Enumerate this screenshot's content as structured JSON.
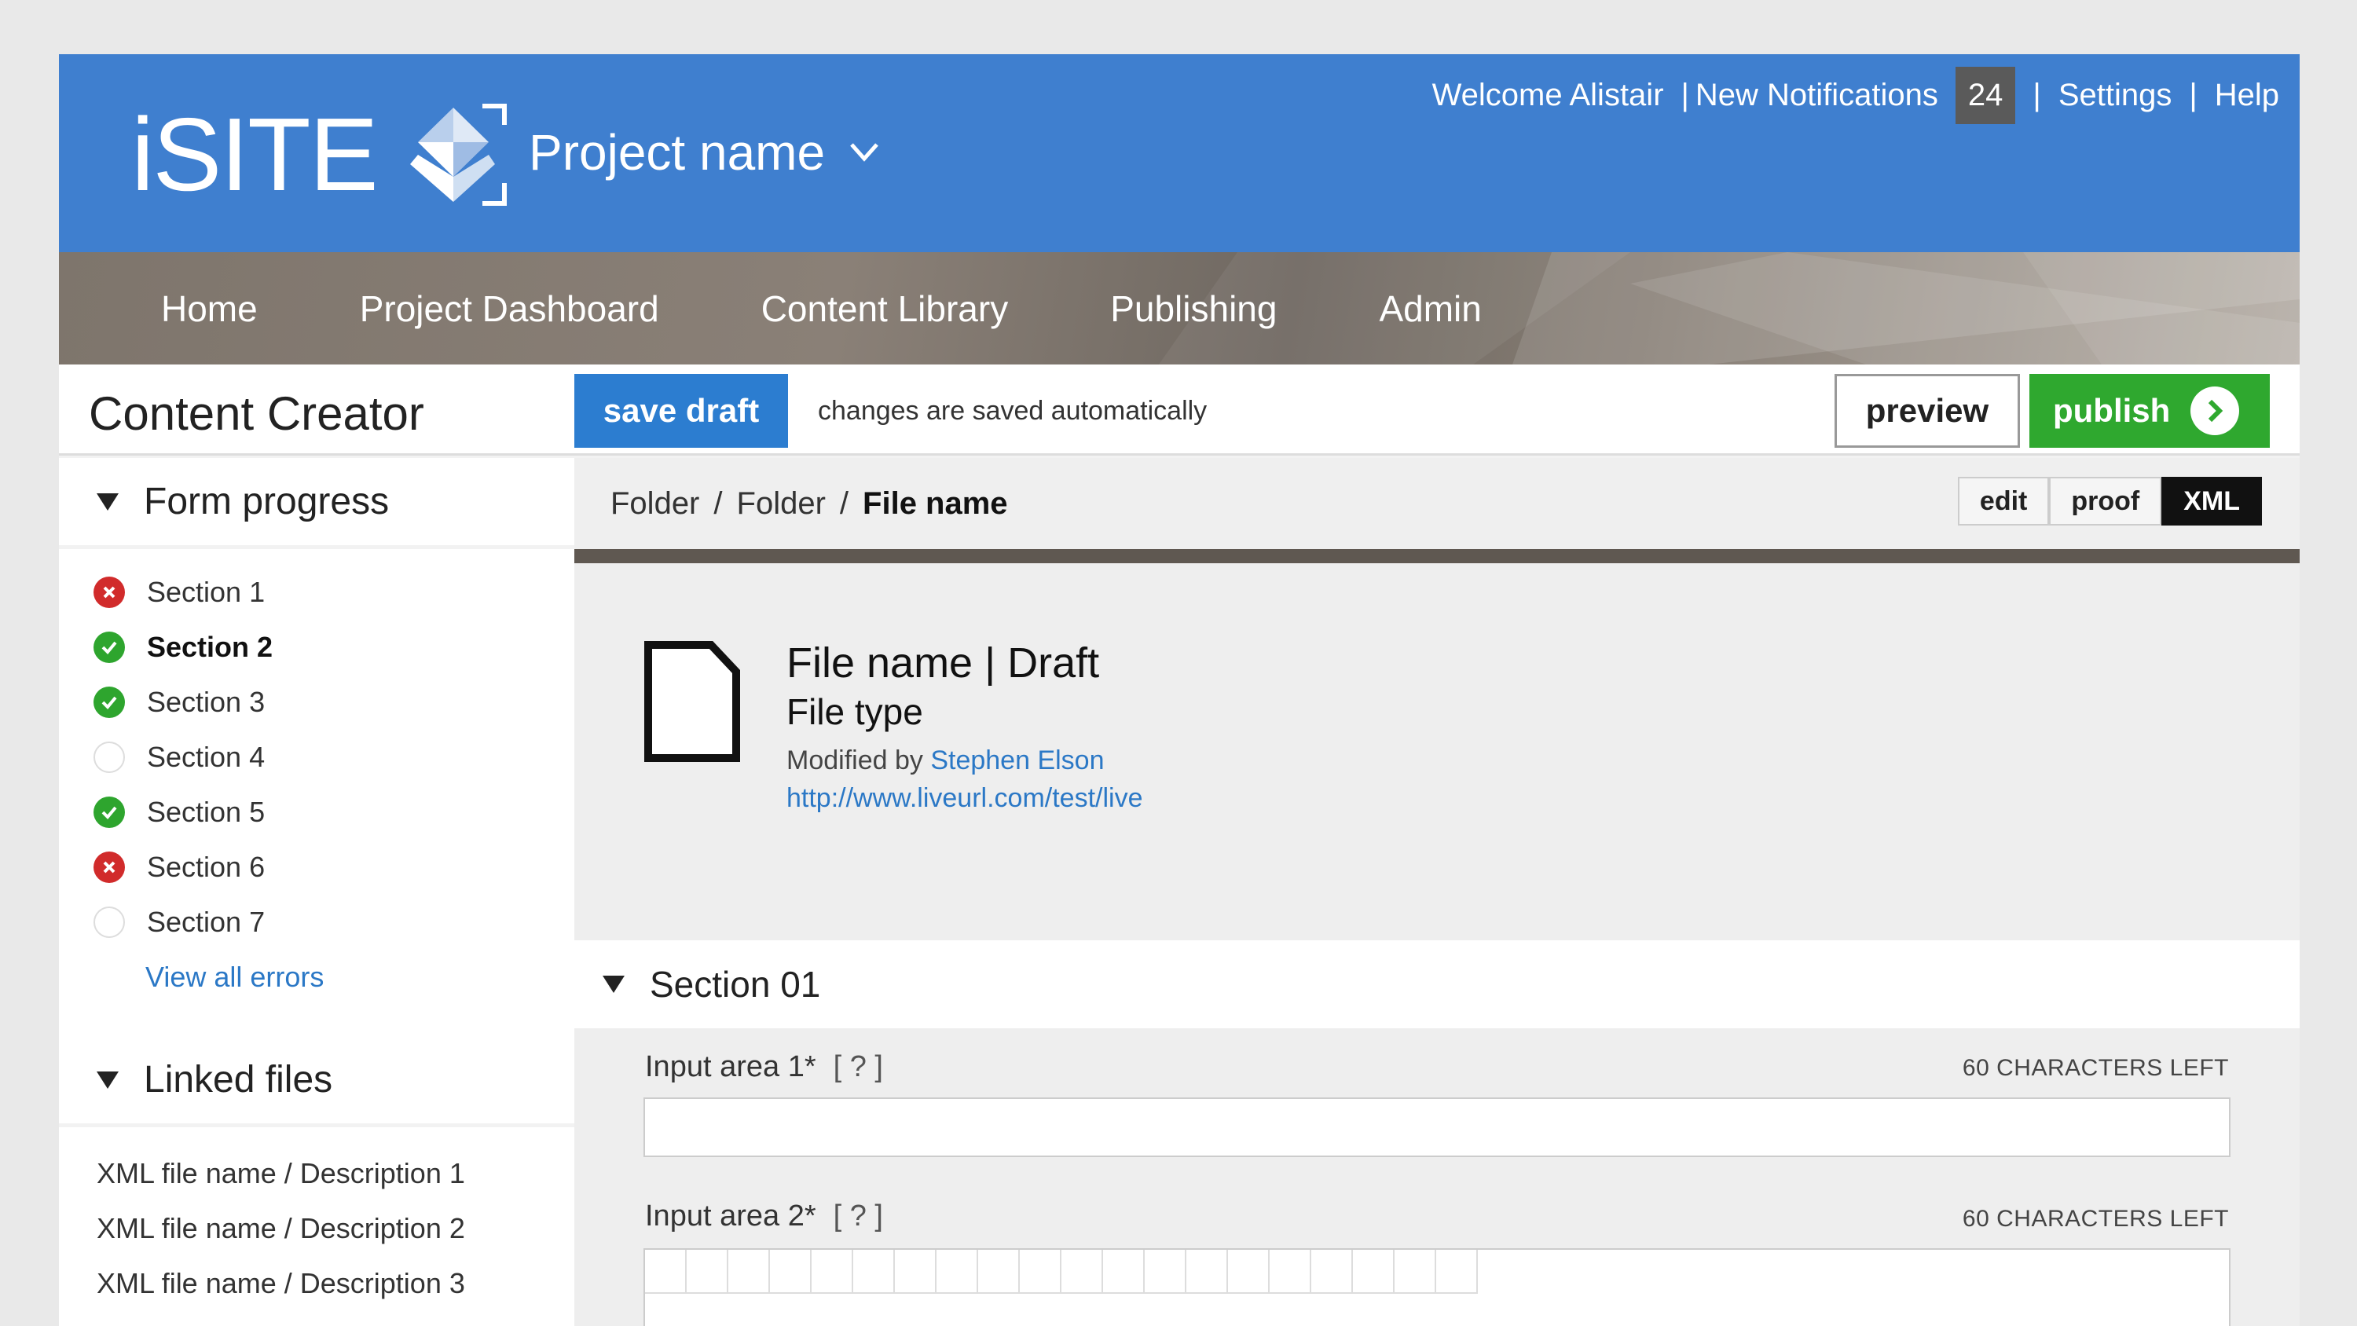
{
  "header": {
    "logo_text": "iSITE",
    "project_name": "Project name",
    "welcome": "Welcome Alistair",
    "notifications_label": "New Notifications",
    "notifications_count": "24",
    "settings": "Settings",
    "help": "Help",
    "separator": "|",
    "brand_color": "#3f7fcf"
  },
  "nav": {
    "items": [
      "Home",
      "Project Dashboard",
      "Content Library",
      "Publishing",
      "Admin"
    ]
  },
  "toolbar": {
    "title": "Content Creator",
    "save_label": "save draft",
    "autosave_text": "changes are saved automatically",
    "preview_label": "preview",
    "publish_label": "publish"
  },
  "sidebar": {
    "progress_title": "Form progress",
    "sections": [
      {
        "label": "Section 1",
        "status": "error"
      },
      {
        "label": "Section 2",
        "status": "complete"
      },
      {
        "label": "Section 3",
        "status": "complete"
      },
      {
        "label": "Section 4",
        "status": "empty"
      },
      {
        "label": "Section 5",
        "status": "complete"
      },
      {
        "label": "Section 6",
        "status": "error"
      },
      {
        "label": "Section 7",
        "status": "empty"
      }
    ],
    "view_errors": "View all errors",
    "linked_title": "Linked files",
    "linked_files": [
      "XML file name / Description 1",
      "XML file name / Description 2",
      "XML file name / Description 3"
    ]
  },
  "breadcrumb": {
    "items": [
      "Folder",
      "Folder"
    ],
    "current": "File name",
    "separator": "/"
  },
  "modes": [
    "edit",
    "proof",
    "XML"
  ],
  "active_mode": "XML",
  "file": {
    "title": "File name | Draft",
    "type": "File type",
    "modified_prefix": "Modified by",
    "modified_by": "Stephen Elson",
    "url": "http://www.liveurl.com/test/live"
  },
  "section": {
    "title": "Section 01",
    "fields": [
      {
        "label": "Input area 1*",
        "help": "[ ? ]",
        "chars_left": "60 CHARACTERS LEFT",
        "value": ""
      },
      {
        "label": "Input area 2*",
        "help": "[ ? ]",
        "chars_left": "60 CHARACTERS LEFT",
        "value": ""
      }
    ]
  },
  "colors": {
    "accent": "#2c7dd0",
    "publish": "#2fa82f",
    "error": "#d12b2b",
    "success": "#2ea52e",
    "nav": "#7e756c"
  }
}
